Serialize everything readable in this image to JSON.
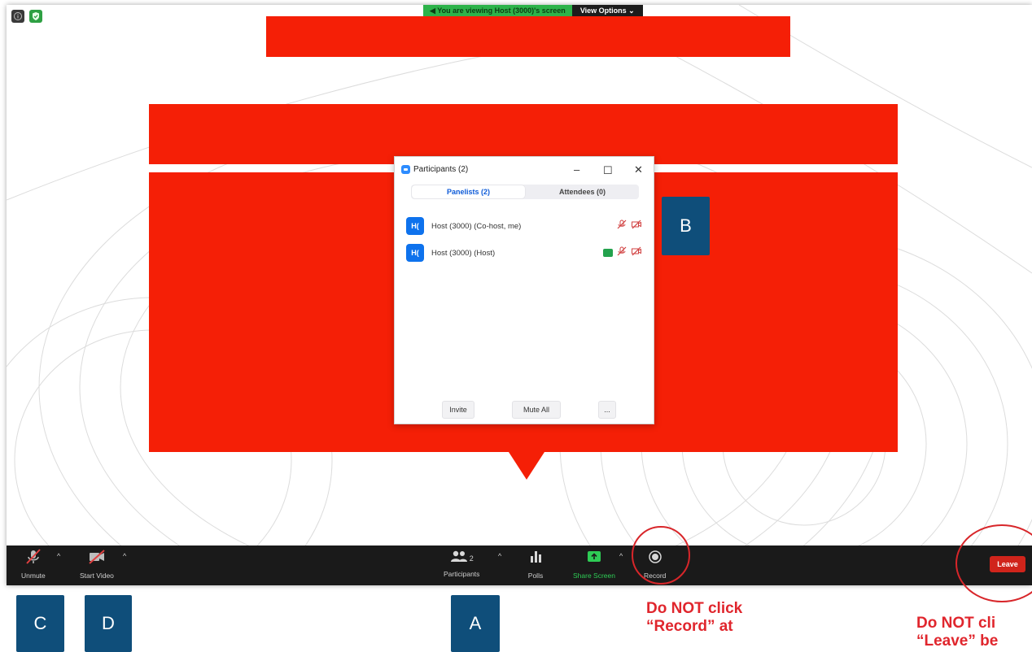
{
  "banner": {
    "viewing_text": "You are viewing Host (3000)'s screen",
    "view_options": "View Options"
  },
  "participants_panel": {
    "title": "Participants (2)",
    "tabs": [
      {
        "label": "Panelists (2)",
        "active": true
      },
      {
        "label": "Attendees (0)",
        "active": false
      }
    ],
    "rows": [
      {
        "avatar": "H(",
        "name": "Host (3000) (Co-host, me)",
        "sharing": false
      },
      {
        "avatar": "H(",
        "name": "Host (3000) (Host)",
        "sharing": true
      }
    ],
    "buttons": {
      "invite": "Invite",
      "mute_all": "Mute All",
      "more": "..."
    }
  },
  "toolbar": {
    "unmute": "Unmute",
    "start_video": "Start Video",
    "participants": "Participants",
    "participants_count": "2",
    "polls": "Polls",
    "share_screen": "Share Screen",
    "record": "Record",
    "leave": "Leave"
  },
  "annotations": {
    "marker_a": "A",
    "marker_b": "B",
    "marker_c": "C",
    "marker_d": "D",
    "record_warning_line1": "Do NOT click",
    "record_warning_line2": "“Record” at",
    "leave_warning_line1": "Do NOT cli",
    "leave_warning_line2": "“Leave” be"
  },
  "colors": {
    "red_block": "#f51f06",
    "marker_blue": "#0f4e7a",
    "warning_red": "#e0262d",
    "toolbar_bg": "#1a1a1a",
    "zoom_blue": "#0e72ed",
    "share_green": "#2ecc55"
  }
}
